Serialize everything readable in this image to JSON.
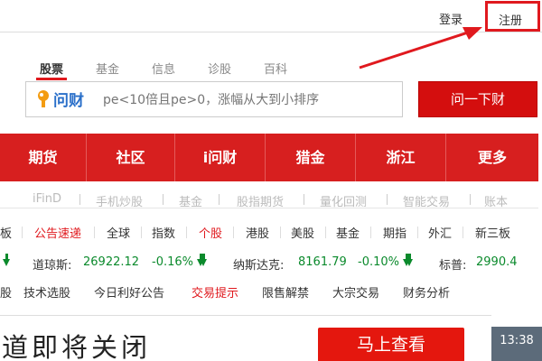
{
  "header": {
    "login_label": "登录",
    "register_label": "注册"
  },
  "search": {
    "tabs": [
      {
        "label": "股票",
        "active": true
      },
      {
        "label": "基金",
        "active": false
      },
      {
        "label": "信息",
        "active": false
      },
      {
        "label": "诊股",
        "active": false
      },
      {
        "label": "百科",
        "active": false
      }
    ],
    "logo_text": "问财",
    "placeholder": "pe<10倍且pe>0，涨幅从大到小排序",
    "button_label": "问一下财"
  },
  "main_nav": [
    {
      "label": "期货"
    },
    {
      "label": "社区"
    },
    {
      "label": "i问财"
    },
    {
      "label": "猎金"
    },
    {
      "label": "浙江"
    },
    {
      "label": "更多"
    }
  ],
  "sub_nav": [
    {
      "label": "iFinD"
    },
    {
      "label": "手机炒股"
    },
    {
      "label": "基金"
    },
    {
      "label": "股指期货"
    },
    {
      "label": "量化回测"
    },
    {
      "label": "智能交易"
    },
    {
      "label": "账本"
    }
  ],
  "link_row": [
    {
      "label": "板",
      "red": false
    },
    {
      "label": "公告速递",
      "red": true
    },
    {
      "label": "全球",
      "red": false
    },
    {
      "label": "指数",
      "red": false
    },
    {
      "label": "个股",
      "red": true
    },
    {
      "label": "港股",
      "red": false
    },
    {
      "label": "美股",
      "red": false
    },
    {
      "label": "基金",
      "red": false
    },
    {
      "label": "期指",
      "red": false
    },
    {
      "label": "外汇",
      "red": false
    },
    {
      "label": "新三板",
      "red": false
    }
  ],
  "indices": [
    {
      "name": "道琼斯:",
      "value": "26922.12",
      "change": "-0.16%"
    },
    {
      "name": "纳斯达克:",
      "value": "8161.79",
      "change": "-0.10%"
    },
    {
      "name": "标普:",
      "value": "2990.4",
      "change": ""
    }
  ],
  "tools_row": [
    {
      "label": "技术选股",
      "red": false
    },
    {
      "label": "今日利好公告",
      "red": false
    },
    {
      "label": "交易提示",
      "red": true
    },
    {
      "label": "限售解禁",
      "red": false
    },
    {
      "label": "大宗交易",
      "red": false
    },
    {
      "label": "财务分析",
      "red": false
    }
  ],
  "banner": {
    "text": "道即将关闭",
    "button_label": "马上查看",
    "time": "13:38"
  },
  "colors": {
    "brand_red": "#d71f1f",
    "highlight_red": "#e0191e",
    "logo_blue": "#2a6fc9",
    "down_green": "#0b8a2c"
  }
}
